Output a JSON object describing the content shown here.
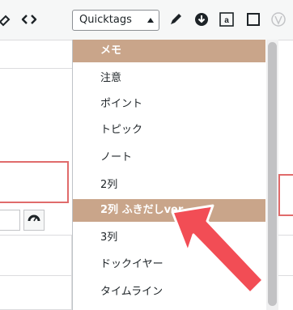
{
  "toolbar": {
    "quicktags_select": {
      "value": "Quicktags"
    }
  },
  "dropdown": {
    "items": [
      {
        "label": "メモ",
        "selected": true
      },
      {
        "label": "注意",
        "selected": false
      },
      {
        "label": "ポイント",
        "selected": false
      },
      {
        "label": "トピック",
        "selected": false
      },
      {
        "label": "ノート",
        "selected": false
      },
      {
        "label": "2列",
        "selected": false
      },
      {
        "label": "2列 ふきだしver",
        "selected": true
      },
      {
        "label": "3列",
        "selected": false
      },
      {
        "label": "ドックイヤー",
        "selected": false
      },
      {
        "label": "タイムライン",
        "selected": false
      }
    ]
  },
  "colors": {
    "highlight": "#c9a58a",
    "annotation_box": "#e06b6b",
    "arrow": "#f24d55"
  }
}
